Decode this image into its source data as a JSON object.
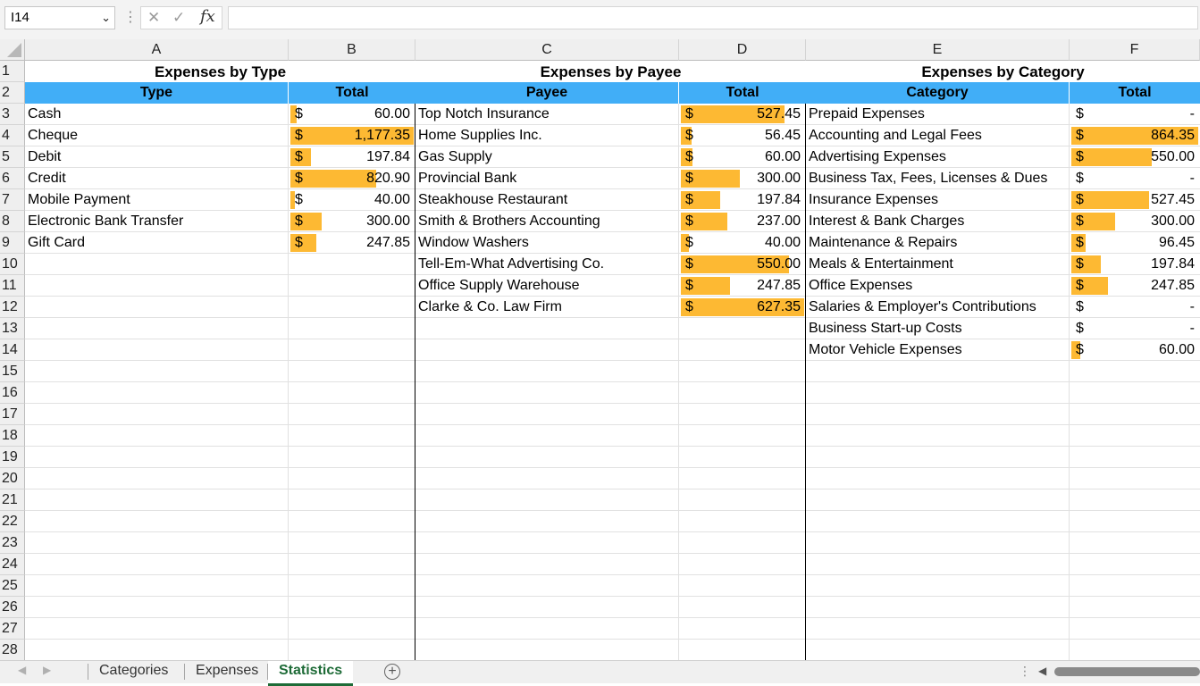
{
  "formula_bar": {
    "name_box": "I14",
    "cancel_icon": "✕",
    "enter_icon": "✓",
    "fx": "fx",
    "formula": ""
  },
  "columns": [
    "A",
    "B",
    "C",
    "D",
    "E",
    "F"
  ],
  "rows": [
    "1",
    "2",
    "3",
    "4",
    "5",
    "6",
    "7",
    "8",
    "9",
    "10",
    "11",
    "12",
    "13",
    "14",
    "15",
    "16",
    "17",
    "18",
    "19",
    "20",
    "21",
    "22",
    "23",
    "24",
    "25",
    "26",
    "27",
    "28"
  ],
  "colors": {
    "header_fill": "#41aef7",
    "databar": "#fdb933",
    "active_tab": "#1e6b37"
  },
  "tables": [
    {
      "title": "Expenses by Type",
      "headers": [
        "Type",
        "Total"
      ],
      "max": 1177.35,
      "rows": [
        {
          "label": "Cash",
          "total": "60.00",
          "value": 60.0
        },
        {
          "label": "Cheque",
          "total": "1,177.35",
          "value": 1177.35
        },
        {
          "label": "Debit",
          "total": "197.84",
          "value": 197.84
        },
        {
          "label": "Credit",
          "total": "820.90",
          "value": 820.9
        },
        {
          "label": "Mobile Payment",
          "total": "40.00",
          "value": 40.0
        },
        {
          "label": "Electronic Bank Transfer",
          "total": "300.00",
          "value": 300.0
        },
        {
          "label": "Gift Card",
          "total": "247.85",
          "value": 247.85
        }
      ]
    },
    {
      "title": "Expenses by Payee",
      "headers": [
        "Payee",
        "Total"
      ],
      "max": 627.35,
      "rows": [
        {
          "label": "Top Notch Insurance",
          "total": "527.45",
          "value": 527.45
        },
        {
          "label": "Home Supplies Inc.",
          "total": "56.45",
          "value": 56.45
        },
        {
          "label": "Gas Supply",
          "total": "60.00",
          "value": 60.0
        },
        {
          "label": "Provincial Bank",
          "total": "300.00",
          "value": 300.0
        },
        {
          "label": "Steakhouse Restaurant",
          "total": "197.84",
          "value": 197.84
        },
        {
          "label": "Smith & Brothers Accounting",
          "total": "237.00",
          "value": 237.0
        },
        {
          "label": "Window Washers",
          "total": "40.00",
          "value": 40.0
        },
        {
          "label": "Tell-Em-What Advertising Co.",
          "total": "550.00",
          "value": 550.0
        },
        {
          "label": "Office Supply Warehouse",
          "total": "247.85",
          "value": 247.85
        },
        {
          "label": "Clarke & Co. Law Firm",
          "total": "627.35",
          "value": 627.35
        }
      ]
    },
    {
      "title": "Expenses by Category",
      "headers": [
        "Category",
        "Total"
      ],
      "max": 864.35,
      "rows": [
        {
          "label": "Prepaid Expenses",
          "total": "-",
          "value": 0
        },
        {
          "label": "Accounting and Legal Fees",
          "total": "864.35",
          "value": 864.35
        },
        {
          "label": "Advertising Expenses",
          "total": "550.00",
          "value": 550.0
        },
        {
          "label": "Business Tax, Fees, Licenses & Dues",
          "total": "-",
          "value": 0
        },
        {
          "label": "Insurance Expenses",
          "total": "527.45",
          "value": 527.45
        },
        {
          "label": "Interest & Bank Charges",
          "total": "300.00",
          "value": 300.0
        },
        {
          "label": "Maintenance & Repairs",
          "total": "96.45",
          "value": 96.45
        },
        {
          "label": "Meals & Entertainment",
          "total": "197.84",
          "value": 197.84
        },
        {
          "label": "Office Expenses",
          "total": "247.85",
          "value": 247.85
        },
        {
          "label": "Salaries & Employer's Contributions",
          "total": "-",
          "value": 0
        },
        {
          "label": "Business Start-up Costs",
          "total": "-",
          "value": 0
        },
        {
          "label": "Motor Vehicle Expenses",
          "total": "60.00",
          "value": 60.0
        }
      ]
    }
  ],
  "currency_symbol": "$",
  "sheet_tabs": [
    {
      "label": "Categories",
      "active": false
    },
    {
      "label": "Expenses",
      "active": false
    },
    {
      "label": "Statistics",
      "active": true
    }
  ],
  "add_sheet_symbol": "+"
}
